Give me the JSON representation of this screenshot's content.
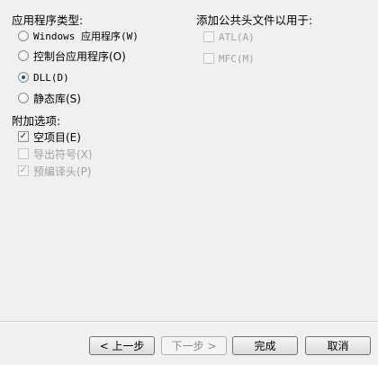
{
  "app_type": {
    "title": "应用程序类型:",
    "options": [
      {
        "label": "Windows 应用程序(W)",
        "checked": false
      },
      {
        "label": "控制台应用程序(O)",
        "checked": false
      },
      {
        "label": "DLL(D)",
        "checked": true
      },
      {
        "label": "静态库(S)",
        "checked": false
      }
    ]
  },
  "additional_options": {
    "title": "附加选项:",
    "empty_project": {
      "label": "空项目(E)",
      "checked": true,
      "check_mark": "✓"
    },
    "export_symbols": {
      "label": "导出符号(X)",
      "checked": false
    },
    "precompiled_header": {
      "label": "预编译头(P)",
      "checked": true,
      "check_mark": "✓"
    }
  },
  "common_headers": {
    "title": "添加公共头文件以用于:",
    "atl": {
      "label": "ATL(A)",
      "checked": false
    },
    "mfc": {
      "label": "MFC(M)",
      "checked": false
    }
  },
  "buttons": {
    "back": "< 上一步",
    "next": "下一步 >",
    "finish": "完成",
    "cancel": "取消"
  }
}
